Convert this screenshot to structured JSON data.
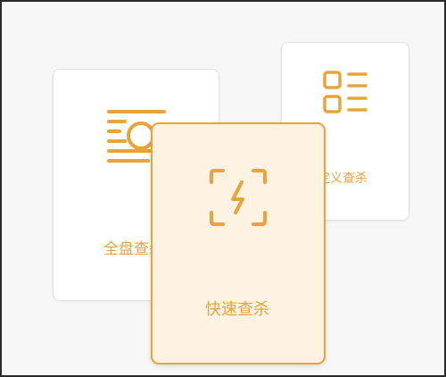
{
  "scan_modes": {
    "full": {
      "label": "全盘查杀",
      "icon": "disk-scan-icon"
    },
    "custom": {
      "label": "自定义查杀",
      "icon": "custom-list-icon"
    },
    "quick": {
      "label": "快速查杀",
      "icon": "lightning-scan-icon"
    }
  },
  "colors": {
    "accent": "#e8a33a",
    "selected_background": "#fef3e3",
    "card_background": "#ffffff",
    "page_background": "#f7f7f7"
  }
}
